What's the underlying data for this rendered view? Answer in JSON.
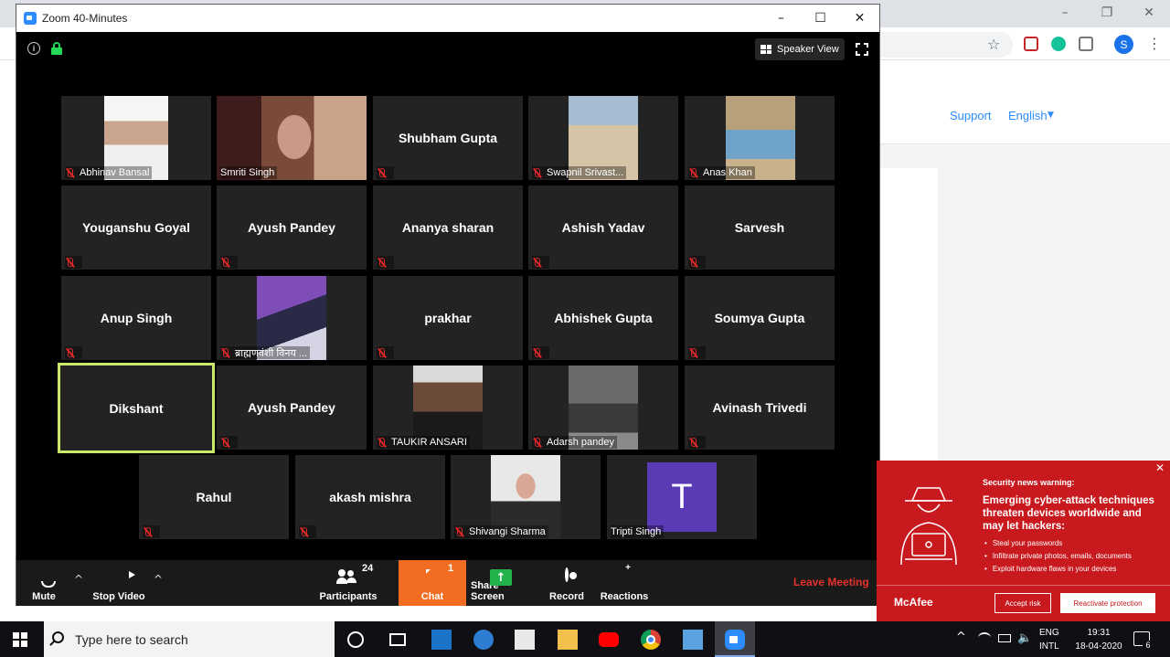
{
  "zoom": {
    "window_title": "Zoom 40-Minutes",
    "speaker_view_label": "Speaker View",
    "tiles": [
      {
        "name": "Abhinav Bansal",
        "video": true
      },
      {
        "name": "Smriti Singh",
        "video": true
      },
      {
        "name": "Shubham Gupta",
        "video": false
      },
      {
        "name": "Swapnil Srivast...",
        "video": true
      },
      {
        "name": "Anas Khan",
        "video": true
      },
      {
        "name": "Youganshu Goyal",
        "video": false
      },
      {
        "name": "Ayush Pandey",
        "video": false
      },
      {
        "name": "Ananya sharan",
        "video": false
      },
      {
        "name": "Ashish Yadav",
        "video": false
      },
      {
        "name": "Sarvesh",
        "video": false
      },
      {
        "name": "Anup Singh",
        "video": false
      },
      {
        "name": "ब्राह्मणवंशी विनय ...",
        "video": true
      },
      {
        "name": "prakhar",
        "video": false
      },
      {
        "name": "Abhishek Gupta",
        "video": false
      },
      {
        "name": "Soumya Gupta",
        "video": false
      },
      {
        "name": "Dikshant",
        "video": false,
        "active_speaker": true
      },
      {
        "name": "Ayush Pandey",
        "video": false
      },
      {
        "name": "TAUKIR ANSARI",
        "video": true
      },
      {
        "name": "Adarsh pandey",
        "video": true
      },
      {
        "name": "Avinash Trivedi",
        "video": false
      },
      {
        "name": "Rahul",
        "video": false
      },
      {
        "name": "akash mishra",
        "video": false
      },
      {
        "name": "Shivangi Sharma",
        "video": true
      },
      {
        "name": "Tripti Singh",
        "video": false,
        "avatar_letter": "T",
        "avatar_color": "#5b3ab5"
      }
    ],
    "controls": {
      "mute": "Mute",
      "stop_video": "Stop Video",
      "participants": "Participants",
      "participants_count": "24",
      "chat": "Chat",
      "chat_unread": "1",
      "share_screen": "Share Screen",
      "record": "Record",
      "reactions": "Reactions",
      "leave": "Leave Meeting"
    }
  },
  "browser": {
    "support_link": "Support",
    "language": "English",
    "profile_initial": "S"
  },
  "mcafee": {
    "warning_title": "Security news warning:",
    "headline": "Emerging cyber-attack techniques threaten devices worldwide and may let hackers:",
    "bullets": [
      "Steal your passwords",
      "Infiltrate private photos, emails, documents",
      "Exploit hardware flaws in your devices"
    ],
    "logo": "McAfee",
    "accept_risk": "Accept risk",
    "reactivate": "Reactivate protection",
    "accent_color": "#c8191e"
  },
  "taskbar": {
    "search_placeholder": "Type here to search",
    "language_line1": "ENG",
    "language_line2": "INTL",
    "time": "19:31",
    "date": "18-04-2020",
    "notification_count": "6"
  },
  "colors": {
    "zoom_blue": "#2d8cff",
    "chat_orange": "#f26d21",
    "leave_red": "#e5312b",
    "active_speaker": "#cbe86b",
    "share_green": "#23b24b"
  }
}
